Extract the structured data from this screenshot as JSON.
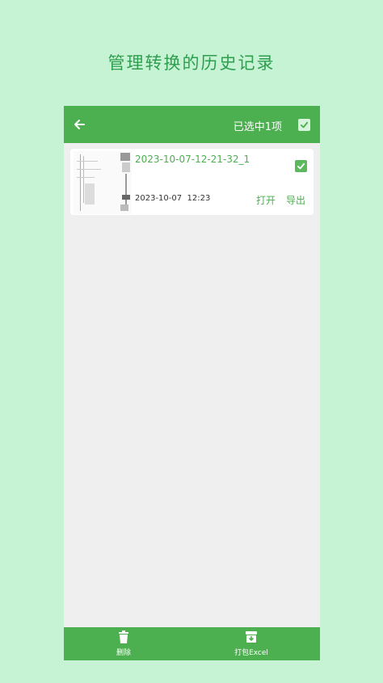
{
  "promo": {
    "title": "管理转换的历史记录"
  },
  "appbar": {
    "selected_text": "已选中1项"
  },
  "history": {
    "items": [
      {
        "name": "2023-10-07-12-21-32_1",
        "date": "2023-10-07",
        "time": "12:23",
        "open_label": "打开",
        "export_label": "导出"
      }
    ]
  },
  "bottombar": {
    "delete_label": "删除",
    "pack_label": "打包Excel"
  },
  "colors": {
    "accent": "#4caf50",
    "background": "#c6f3d3",
    "list_bg": "#efefef"
  },
  "icons": {
    "back": "arrow-left-icon",
    "check": "checkmark-icon",
    "delete": "trash-icon",
    "pack": "archive-icon"
  }
}
